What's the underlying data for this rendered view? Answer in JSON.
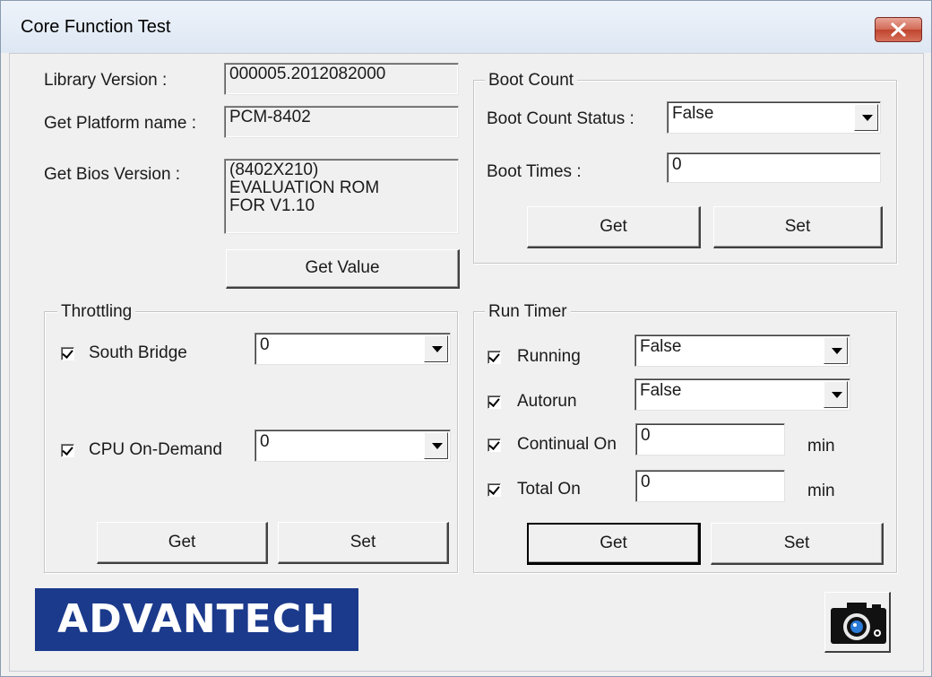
{
  "window": {
    "title": "Core Function Test"
  },
  "info": {
    "library_version_label": "Library Version :",
    "library_version_value": "000005.2012082000",
    "platform_name_label": "Get Platform name :",
    "platform_name_value": "PCM-8402",
    "bios_version_label": "Get Bios Version :",
    "bios_version_value": "(8402X210)\nEVALUATION ROM\nFOR V1.10",
    "get_value_button": "Get Value"
  },
  "boot_count": {
    "title": "Boot Count",
    "status_label": "Boot Count Status :",
    "status_value": "False",
    "times_label": "Boot Times :",
    "times_value": "0",
    "get_button": "Get",
    "set_button": "Set"
  },
  "throttling": {
    "title": "Throttling",
    "south_bridge_label": "South Bridge",
    "south_bridge_checked": true,
    "south_bridge_value": "0",
    "cpu_on_demand_label": "CPU On-Demand",
    "cpu_on_demand_checked": true,
    "cpu_on_demand_value": "0",
    "get_button": "Get",
    "set_button": "Set"
  },
  "run_timer": {
    "title": "Run Timer",
    "running_label": "Running",
    "running_checked": true,
    "running_value": "False",
    "autorun_label": "Autorun",
    "autorun_checked": true,
    "autorun_value": "False",
    "continual_on_label": "Continual On",
    "continual_on_checked": true,
    "continual_on_value": "0",
    "continual_on_unit": "min",
    "total_on_label": "Total On",
    "total_on_checked": true,
    "total_on_value": "0",
    "total_on_unit": "min",
    "get_button": "Get",
    "set_button": "Set"
  },
  "footer": {
    "logo_text": "ADVANTECH",
    "logo_color": "#1b3a8c",
    "camera_icon": "camera-icon"
  }
}
